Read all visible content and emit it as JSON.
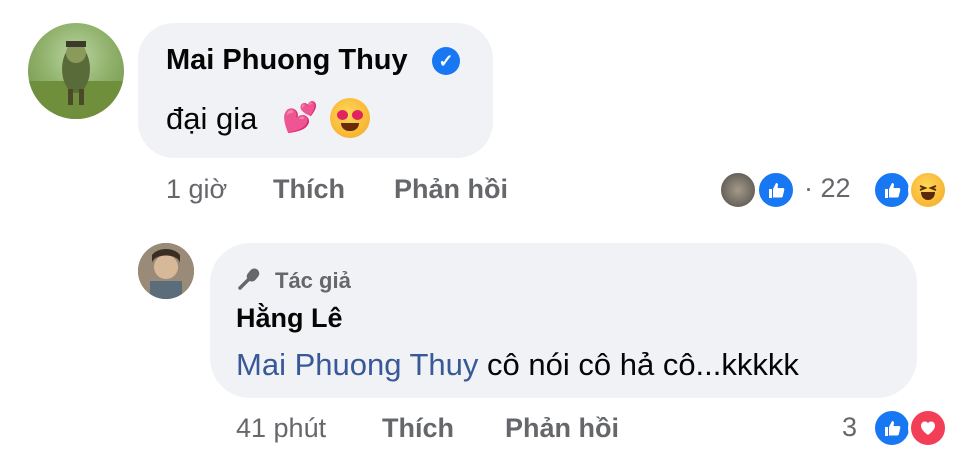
{
  "comment": {
    "author": "Mai Phuong Thuy",
    "text": "đại gia",
    "hearts_emoji": "💕",
    "time": "1 giờ",
    "like_label": "Thích",
    "reply_label": "Phản hồi",
    "reactions_count": "· 22"
  },
  "reply": {
    "author_badge": "Tác giả",
    "author": "Hằng Lê",
    "mention": "Mai Phuong Thuy",
    "text": " cô nói cô hả cô...kkkkk",
    "time": "41 phút",
    "like_label": "Thích",
    "reply_label": "Phản hồi",
    "reactions_count": "3"
  },
  "colors": {
    "bubble": "#f0f2f5",
    "like_blue": "#1877f2",
    "love_red": "#f33e58",
    "mention": "#385898",
    "meta_gray": "#65676b"
  }
}
